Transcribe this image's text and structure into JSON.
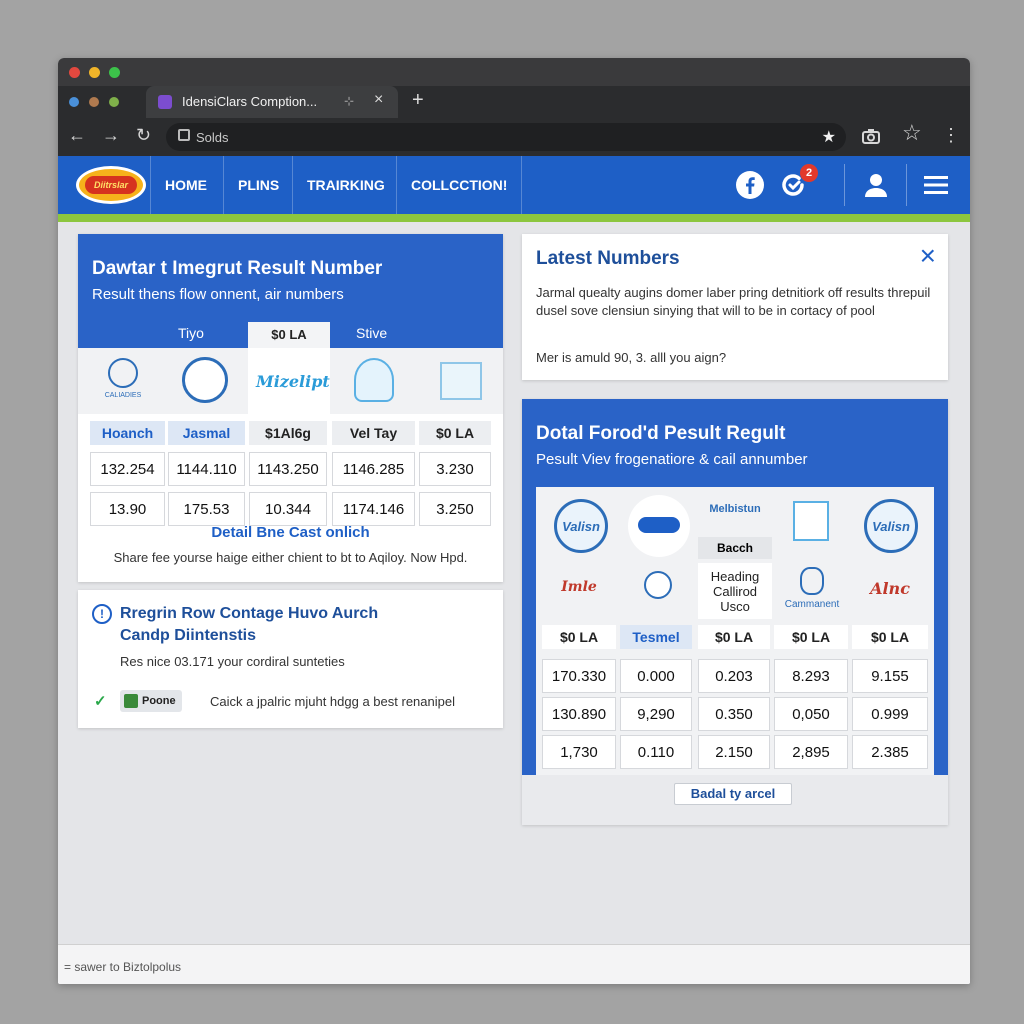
{
  "browser": {
    "tab_title": "IdensiClars Comption...",
    "tab_close": "×",
    "new_tab": "+",
    "address": "Solds"
  },
  "nav": {
    "logo_text": "Diitrslar",
    "items": [
      "HOME",
      "PLINS",
      "TRAIRKING",
      "COLLCCTION!"
    ],
    "notification_count": "2"
  },
  "left_card": {
    "title": "Dawtar t Imegrut Result Number",
    "subtitle": "Result thens flow onnent, air numbers",
    "tabs": [
      "Tiyo",
      "$0 LA",
      "Stive"
    ],
    "logo_labels": [
      "CALIADIES",
      "Mizelipt"
    ],
    "columns": [
      "Hoanch",
      "Jasmal",
      "$1Al6g",
      "Vel Tay",
      "$0 LA"
    ],
    "rows": [
      [
        "132.254",
        "1144.110",
        "1143.250",
        "1146.285",
        "3.230"
      ],
      [
        "13.90",
        "175.53",
        "10.344",
        "1174.146",
        "3.250"
      ]
    ],
    "link": "Detail Bne Cast onlich",
    "note": "Share fee yourse haige either chient to bt to Aqiloy. Now Hpd."
  },
  "info_card": {
    "title_line1": "Rregrin Row Contage Huvo Aurch",
    "title_line2": "Candp Diintenstis",
    "body": "Res nice 03.171 your cordiral sunteties",
    "pill": "Poone",
    "pill_note": "Caick a jpalric mjuht hdgg a best renanipel"
  },
  "latest": {
    "title": "Latest Numbers",
    "close": "×",
    "body": "Jarmal quealty augins domer laber pring detnitiork off results threpuil dusel sove clensiun sinying that will to be in cortacy of pool",
    "question": "Mer is amuld 90, 3. alll you aign?"
  },
  "results": {
    "title": "Dotal Forod'd Pesult Regult",
    "subtitle": "Pesult Viev frogenatiore & cail annumber",
    "logo_labels": [
      "Valisn",
      "Melbistun",
      "Bacch",
      "Heading Callirod Usco",
      "Valisn",
      "Imle",
      "Cammanent",
      "Alnc"
    ],
    "columns": [
      "$0 LA",
      "Tesmel",
      "$0 LA",
      "$0 LA",
      "$0 LA"
    ],
    "rows": [
      [
        "170.330",
        "0.000",
        "0.203",
        "8.293",
        "9.155"
      ],
      [
        "130.890",
        "9,290",
        "0.350",
        "0,050",
        "0.999"
      ],
      [
        "1,730",
        "0.110",
        "2.150",
        "2,895",
        "2.385"
      ]
    ],
    "button": "Badal ty arcel"
  },
  "footer": {
    "text": "= sawer to Biztolpolus"
  },
  "colors": {
    "brand_blue": "#1e5fc6",
    "accent_green": "#8cc63f",
    "header_blue": "#2a63c7"
  }
}
